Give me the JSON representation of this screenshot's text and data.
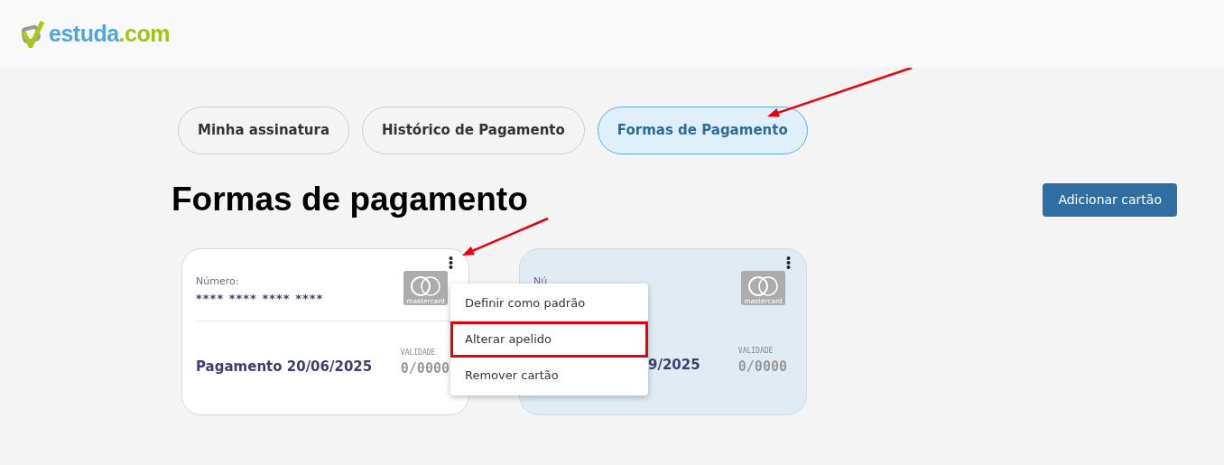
{
  "logo": {
    "name": "estuda",
    "suffix": ".com"
  },
  "tabs": [
    {
      "label": "Minha assinatura",
      "selected": false
    },
    {
      "label": "Histórico de Pagamento",
      "selected": false
    },
    {
      "label": "Formas de Pagamento",
      "selected": true
    }
  ],
  "heading": "Formas de pagamento",
  "add_button": "Adicionar cartão",
  "cards": [
    {
      "number_label": "Número:",
      "number": "**** **** **** ****",
      "brand_label": "mastercard",
      "payment": "Pagamento 20/06/2025",
      "validity_label": "VALIDADE",
      "validity": "0/0000",
      "is_default": false,
      "menu_open": true
    },
    {
      "number_label": "Nú",
      "brand_label": "mastercard",
      "payment": "9/2025",
      "validity_label": "VALIDADE",
      "validity": "0/0000",
      "is_default": true,
      "menu_open": false
    }
  ],
  "card_menu": [
    {
      "label": "Definir como padrão",
      "highlighted": false
    },
    {
      "label": "Alterar apelido",
      "highlighted": true
    },
    {
      "label": "Remover cartão",
      "highlighted": false
    }
  ],
  "annotations": [
    {
      "kind": "arrow"
    },
    {
      "kind": "arrow"
    }
  ]
}
